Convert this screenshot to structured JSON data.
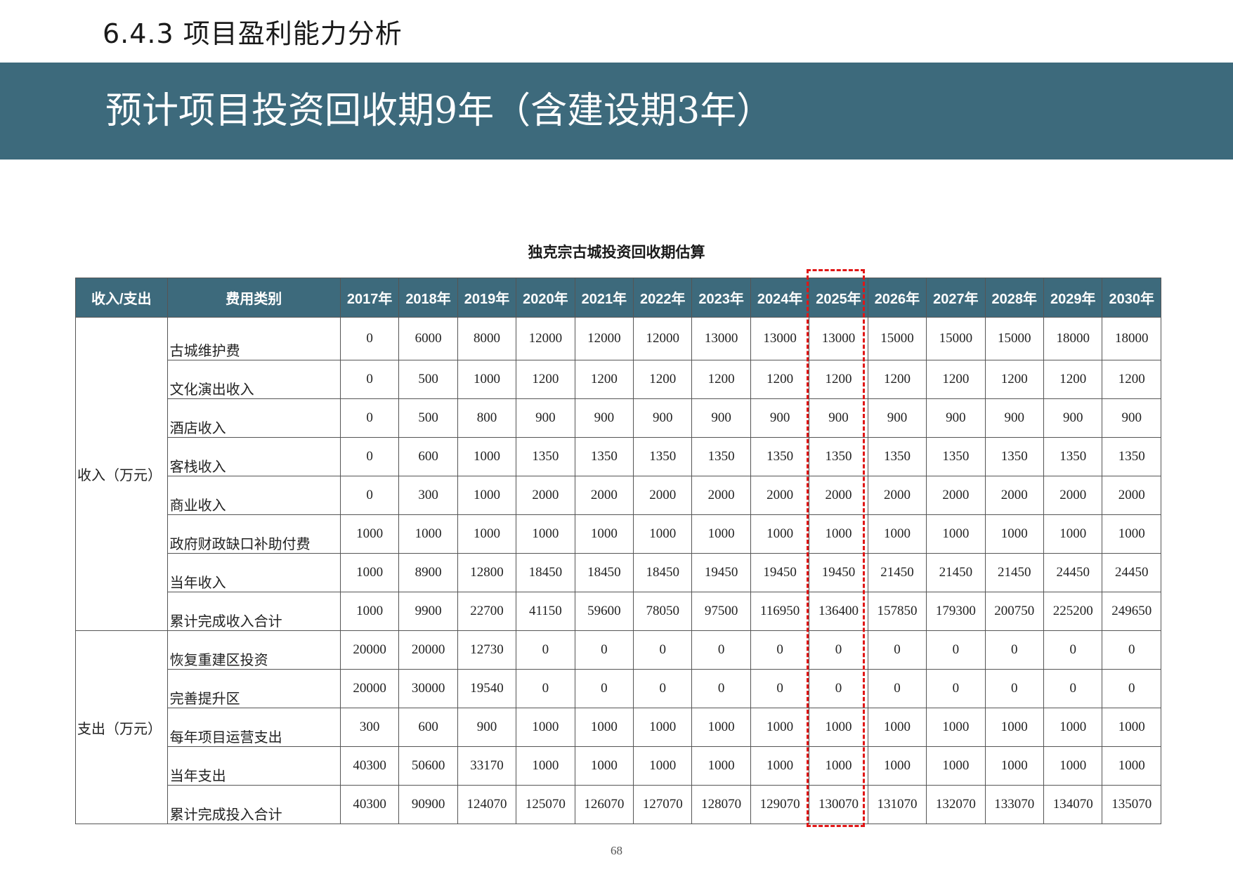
{
  "section_heading": "6.4.3 项目盈利能力分析",
  "banner_title": "预计项目投资回收期9年（含建设期3年）",
  "table": {
    "caption": "独克宗古城投资回收期估算",
    "headers": [
      "收入/支出",
      "费用类别",
      "2017年",
      "2018年",
      "2019年",
      "2020年",
      "2021年",
      "2022年",
      "2023年",
      "2024年",
      "2025年",
      "2026年",
      "2027年",
      "2028年",
      "2029年",
      "2030年"
    ],
    "highlighted_year": "2025年",
    "groups": [
      {
        "label": "收入（万元）",
        "rows": [
          {
            "category": "古城维护费",
            "values": [
              "0",
              "6000",
              "8000",
              "12000",
              "12000",
              "12000",
              "13000",
              "13000",
              "13000",
              "15000",
              "15000",
              "15000",
              "18000",
              "18000"
            ]
          },
          {
            "category": "文化演出收入",
            "values": [
              "0",
              "500",
              "1000",
              "1200",
              "1200",
              "1200",
              "1200",
              "1200",
              "1200",
              "1200",
              "1200",
              "1200",
              "1200",
              "1200"
            ]
          },
          {
            "category": "酒店收入",
            "values": [
              "0",
              "500",
              "800",
              "900",
              "900",
              "900",
              "900",
              "900",
              "900",
              "900",
              "900",
              "900",
              "900",
              "900"
            ]
          },
          {
            "category": "客栈收入",
            "values": [
              "0",
              "600",
              "1000",
              "1350",
              "1350",
              "1350",
              "1350",
              "1350",
              "1350",
              "1350",
              "1350",
              "1350",
              "1350",
              "1350"
            ]
          },
          {
            "category": "商业收入",
            "values": [
              "0",
              "300",
              "1000",
              "2000",
              "2000",
              "2000",
              "2000",
              "2000",
              "2000",
              "2000",
              "2000",
              "2000",
              "2000",
              "2000"
            ]
          },
          {
            "category": "政府财政缺口补助付费",
            "values": [
              "1000",
              "1000",
              "1000",
              "1000",
              "1000",
              "1000",
              "1000",
              "1000",
              "1000",
              "1000",
              "1000",
              "1000",
              "1000",
              "1000"
            ]
          },
          {
            "category": "当年收入",
            "values": [
              "1000",
              "8900",
              "12800",
              "18450",
              "18450",
              "18450",
              "19450",
              "19450",
              "19450",
              "21450",
              "21450",
              "21450",
              "24450",
              "24450"
            ]
          },
          {
            "category": "累计完成收入合计",
            "values": [
              "1000",
              "9900",
              "22700",
              "41150",
              "59600",
              "78050",
              "97500",
              "116950",
              "136400",
              "157850",
              "179300",
              "200750",
              "225200",
              "249650"
            ]
          }
        ]
      },
      {
        "label": "支出（万元）",
        "rows": [
          {
            "category": "恢复重建区投资",
            "values": [
              "20000",
              "20000",
              "12730",
              "0",
              "0",
              "0",
              "0",
              "0",
              "0",
              "0",
              "0",
              "0",
              "0",
              "0"
            ]
          },
          {
            "category": "完善提升区",
            "values": [
              "20000",
              "30000",
              "19540",
              "0",
              "0",
              "0",
              "0",
              "0",
              "0",
              "0",
              "0",
              "0",
              "0",
              "0"
            ]
          },
          {
            "category": "每年项目运营支出",
            "values": [
              "300",
              "600",
              "900",
              "1000",
              "1000",
              "1000",
              "1000",
              "1000",
              "1000",
              "1000",
              "1000",
              "1000",
              "1000",
              "1000"
            ]
          },
          {
            "category": "当年支出",
            "values": [
              "40300",
              "50600",
              "33170",
              "1000",
              "1000",
              "1000",
              "1000",
              "1000",
              "1000",
              "1000",
              "1000",
              "1000",
              "1000",
              "1000"
            ]
          },
          {
            "category": "累计完成投入合计",
            "values": [
              "40300",
              "90900",
              "124070",
              "125070",
              "126070",
              "127070",
              "128070",
              "129070",
              "130070",
              "131070",
              "132070",
              "133070",
              "134070",
              "135070"
            ]
          }
        ]
      }
    ]
  },
  "page_number": "68",
  "colors": {
    "banner_bg": "#3d6a7c",
    "header_bg": "#3d6a7c",
    "highlight": "#e01616"
  }
}
